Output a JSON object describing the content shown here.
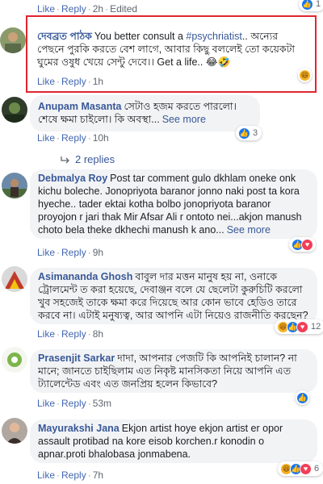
{
  "top_meta": {
    "like": "Like",
    "reply": "Reply",
    "time": "2h",
    "edited": "Edited",
    "reaction_count": "1"
  },
  "comments": [
    {
      "author": "দেবব্রত পাঠক",
      "text_before": "You better consult a ",
      "tag": "#psychriatist",
      "text_after": ".. অন্যের পেছনে পুরকি করতে বেশ লাগে, আবার কিছু বললেই তো কয়েকটা ঘুমের ওষুধ খেয়ে সেন্টু দেবে।। Get a life.. 😂🤣",
      "like": "Like",
      "reply": "Reply",
      "time": "1h",
      "reactions": [
        "haha"
      ],
      "reaction_count": ""
    },
    {
      "author": "Anupam Masanta",
      "text": "সেটাও হজম করতে পারলো। শেষে ক্ষমা চাইলো। কি অবস্থা...",
      "see_more": "See more",
      "like": "Like",
      "reply": "Reply",
      "time": "10h",
      "reactions": [
        "like"
      ],
      "reaction_count": "3"
    },
    {
      "author": "Debmalya Roy",
      "text": "Post tar comment gulo dkhlam oneke onk kichu boleche. Jonopriyota baranor jonno naki post ta kora hyeche.. tader ektai kotha bolbo jonopriyota baranor proyojon r jari thak Mir Afsar Ali r ontoto nei...akjon manush choto bela theke dkhechi manush k ano...",
      "see_more": "See more",
      "like": "Like",
      "reply": "Reply",
      "time": "9h",
      "reactions": [
        "like",
        "love"
      ],
      "reaction_count": ""
    },
    {
      "author": "Asimananda Ghosh",
      "text": "বাবুল দার মত্তন মানুষ হয় না, ওনাকে ট্রোলমেন্ট ত করা হয়েছে, দেবাঞ্জন বলে যে ছেলেটা কুরুচিটি করলো খুব সহজেই তাকে ক্ষমা করে দিয়েছে আর কোন ভাবে হেডিও তারে করবে না। এটাই মনুষ্যত্ব, আর আপনি এটা নিয়েও রাজনীতি করছেন?",
      "like": "Like",
      "reply": "Reply",
      "time": "8h",
      "reactions": [
        "haha",
        "like",
        "love"
      ],
      "reaction_count": "12"
    },
    {
      "author": "Prasenjit Sarkar",
      "text": "দাদা, আপনার পেজটি কি আপনিই চালান? না মানে; জানতে চাইছিলাম এত নিকৃষ্ট মানসিকতা নিয়ে আপনি এত ট্যালেন্টেড এবং এত জনপ্রিয় হলেন কিভাবে?",
      "like": "Like",
      "reply": "Reply",
      "time": "53m",
      "reactions": [
        "like"
      ],
      "reaction_count": ""
    },
    {
      "author": "Mayurakshi Jana",
      "text": "Ekjon artist hoye ekjon artist er opor assault protibad na kore eisob korchen.r konodin o apnar.proti bhalobasa jonmabena.",
      "like": "Like",
      "reply": "Reply",
      "time": "7h",
      "reactions": [
        "haha",
        "like",
        "love"
      ],
      "reaction_count": "6"
    }
  ],
  "replies_link": "2 replies",
  "colors": {
    "link": "#385898",
    "bubble": "#f2f3f5",
    "highlight": "#e0262f",
    "meta": "#606770"
  }
}
